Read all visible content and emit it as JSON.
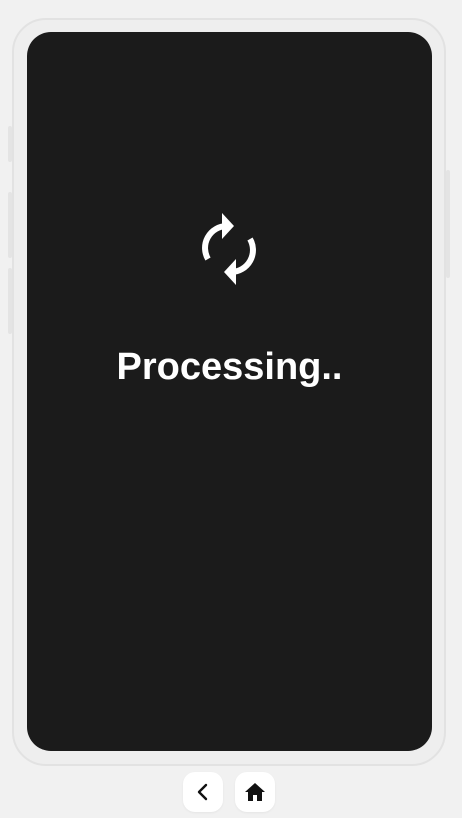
{
  "screen": {
    "status_text": "Processing..",
    "status_icon": "sync-icon",
    "background_color": "#1b1b1b",
    "text_color": "#ffffff"
  },
  "navigation": {
    "back_icon": "chevron-left-icon",
    "home_icon": "home-icon"
  }
}
